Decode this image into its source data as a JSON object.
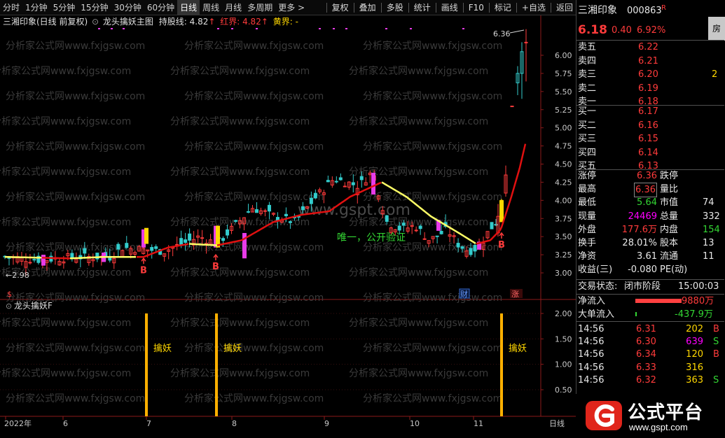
{
  "toolbar": {
    "left": [
      "分时",
      "1分钟",
      "5分钟",
      "15分钟",
      "30分钟",
      "60分钟",
      "日线",
      "周线",
      "月线",
      "多周期",
      "更多 >"
    ],
    "right": [
      "复权",
      "叠加",
      "多股",
      "统计",
      "画线",
      "F10",
      "标记",
      "+自选",
      "返回"
    ],
    "active": "日线"
  },
  "chart_title": {
    "stock": "三湘印象(日线 前复权)",
    "indicator": "龙头擒妖主图",
    "hold_label": "持股线:",
    "hold_value": "4.82",
    "red_label": "红界:",
    "red_value": "4.82",
    "yellow_label": "黄界:",
    "yellow_value": "-"
  },
  "sub_title": "龙头擒妖F",
  "watermark": "分析家公式网www.fxjgsw.com",
  "watermark_center": "www.gspt.com",
  "annotation_green": "唯一，公开验证",
  "labels": {
    "high_price": "6.36",
    "low_price": "←2.98",
    "buy": "B",
    "sub_signal": "擒妖",
    "icon_cai": "财",
    "icon_zhang": "涨",
    "icon_dollar": "$",
    "xaxis_right": "日线"
  },
  "chart_data": [
    {
      "type": "candlestick",
      "title": "龙头擒妖主图",
      "y_ticks": [
        "6.00",
        "5.75",
        "5.50",
        "5.25",
        "5.00",
        "4.75",
        "4.50",
        "4.25",
        "4.00",
        "3.75",
        "3.50",
        "3.25",
        "3.00"
      ],
      "ylim": [
        2.9,
        6.4
      ],
      "x_ticks": [
        "2022年",
        "6",
        "7",
        "8",
        "9",
        "10",
        "11"
      ],
      "high": 6.36,
      "low": 2.98,
      "buy_signals": 3,
      "lines": [
        "持股线",
        "红界",
        "黄界"
      ]
    },
    {
      "type": "bar",
      "title": "龙头擒妖F",
      "y_ticks": [
        "2.00",
        "1.50",
        "1.00",
        "0.50"
      ],
      "ylim": [
        0,
        2.2
      ],
      "signals": [
        {
          "label": "擒妖",
          "value": 2.0
        },
        {
          "label": "擒妖",
          "value": 2.0
        },
        {
          "label": "擒妖",
          "value": 2.0
        }
      ]
    }
  ],
  "quote": {
    "name": "三湘印象",
    "code": "000863",
    "badge": "R",
    "price": "6.18",
    "change": "0.40",
    "pct": "6.92%",
    "side_tab": "房",
    "asks": [
      {
        "label": "卖五",
        "price": "6.22"
      },
      {
        "label": "卖四",
        "price": "6.21"
      },
      {
        "label": "卖三",
        "price": "6.20",
        "vol": "2"
      },
      {
        "label": "卖二",
        "price": "6.19"
      },
      {
        "label": "卖一",
        "price": "6.18"
      }
    ],
    "bids": [
      {
        "label": "买一",
        "price": "6.17"
      },
      {
        "label": "买二",
        "price": "6.16"
      },
      {
        "label": "买三",
        "price": "6.15"
      },
      {
        "label": "买四",
        "price": "6.14"
      },
      {
        "label": "买五",
        "price": "6.13"
      }
    ],
    "stats": [
      {
        "l1": "涨停",
        "v1": "6.36",
        "l2": "跌停",
        "v2": ""
      },
      {
        "l1": "最高",
        "v1": "6.36",
        "l2": "量比",
        "v2": ""
      },
      {
        "l1": "最低",
        "v1": "5.64",
        "l2": "市值",
        "v2": "74"
      },
      {
        "l1": "现量",
        "v1": "24469",
        "l2": "总量",
        "v2": "332"
      },
      {
        "l1": "外盘",
        "v1": "177.6万",
        "l2": "内盘",
        "v2": "154"
      },
      {
        "l1": "换手",
        "v1": "28.01%",
        "l2": "股本",
        "v2": "13"
      },
      {
        "l1": "净资",
        "v1": "3.61",
        "l2": "流通",
        "v2": "11"
      },
      {
        "l1": "收益(三)",
        "v1": "-0.080",
        "l2": "PE(动)",
        "v2": ""
      }
    ],
    "status_label": "交易状态:",
    "status_value": "闭市阶段",
    "status_time": "15:00:03",
    "net_inflow_label": "净流入",
    "net_inflow_value": "9880万",
    "big_inflow_label": "大单流入",
    "big_inflow_value": "-437.9万",
    "ticks": [
      {
        "t": "14:56",
        "p": "6.31",
        "v": "202",
        "s": "B"
      },
      {
        "t": "14:56",
        "p": "6.30",
        "v": "639",
        "s": "S"
      },
      {
        "t": "14:56",
        "p": "6.34",
        "v": "120",
        "s": "B"
      },
      {
        "t": "14:56",
        "p": "6.33",
        "v": "316",
        "s": ""
      },
      {
        "t": "14:56",
        "p": "6.32",
        "v": "363",
        "s": "S"
      }
    ]
  },
  "logo": {
    "name": "公式平台",
    "url": "www.gspt.com",
    "colors": {
      "brand": "#e0251b"
    }
  }
}
